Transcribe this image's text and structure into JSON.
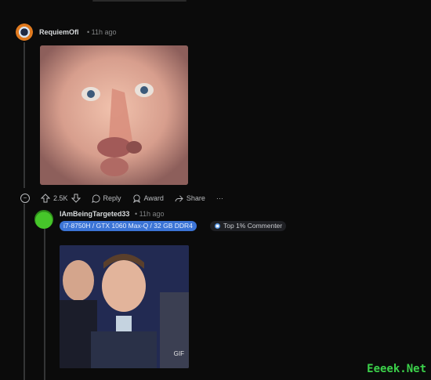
{
  "comment1": {
    "username": "RequiemOfI",
    "time": "• 11h ago",
    "actions": {
      "upvotes": "2.5K",
      "reply": "Reply",
      "award": "Award",
      "share": "Share",
      "more": "···"
    }
  },
  "comment2": {
    "username": "IAmBeingTargeted33",
    "time": "• 11h ago",
    "flair": "i7-8750H / GTX 1060 Max-Q / 32 GB DDR4",
    "badge": "Top 1% Commenter",
    "media_badge": "GIF"
  },
  "icons": [
    "collapse-icon",
    "upvote-icon",
    "downvote-icon",
    "reply-icon",
    "award-icon",
    "share-icon",
    "more-icon"
  ],
  "colors": {
    "background": "#0b0b0b",
    "flair_bg": "#3b74d6",
    "thread_line": "#343536",
    "watermark": "#3bd14a"
  },
  "watermark": "Eeeek.Net"
}
